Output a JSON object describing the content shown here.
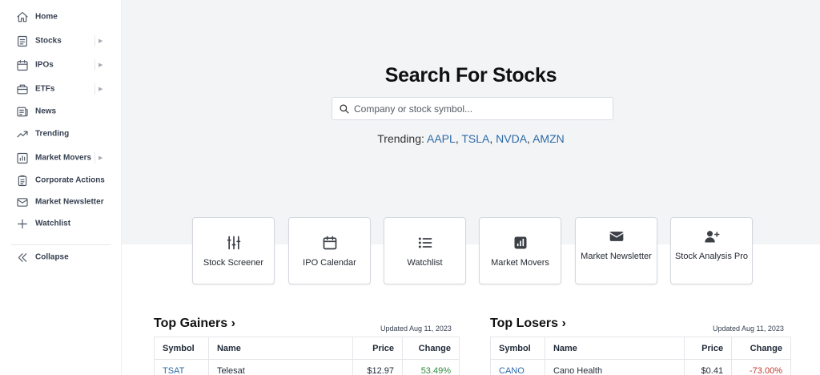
{
  "sidebar": {
    "items": [
      {
        "label": "Home",
        "icon": "home-icon",
        "expandable": false
      },
      {
        "label": "Stocks",
        "icon": "stocks-icon",
        "expandable": true
      },
      {
        "label": "IPOs",
        "icon": "calendar-icon",
        "expandable": true
      },
      {
        "label": "ETFs",
        "icon": "etf-icon",
        "expandable": true
      },
      {
        "label": "News",
        "icon": "news-icon",
        "expandable": false
      },
      {
        "label": "Trending",
        "icon": "trending-icon",
        "expandable": false
      },
      {
        "label": "Market Movers",
        "icon": "bar-chart-icon",
        "expandable": true
      },
      {
        "label": "Corporate Actions",
        "icon": "clipboard-icon",
        "expandable": false
      },
      {
        "label": "Market Newsletter",
        "icon": "envelope-icon",
        "expandable": false
      },
      {
        "label": "Watchlist",
        "icon": "plus-icon",
        "expandable": false
      }
    ],
    "collapse_label": "Collapse",
    "caret": "▶"
  },
  "hero": {
    "title": "Search For Stocks",
    "search_placeholder": "Company or stock symbol...",
    "trending_label": "Trending:",
    "trending_tickers": [
      "AAPL",
      "TSLA",
      "NVDA",
      "AMZN"
    ],
    "separator": ","
  },
  "tools": [
    {
      "label": "Stock Screener",
      "icon": "sliders-icon"
    },
    {
      "label": "IPO Calendar",
      "icon": "calendar-icon"
    },
    {
      "label": "Watchlist",
      "icon": "list-icon"
    },
    {
      "label": "Market Movers",
      "icon": "bar-chart-icon"
    },
    {
      "label": "Market Newsletter",
      "icon": "envelope-icon"
    },
    {
      "label": "Stock Analysis Pro",
      "icon": "user-plus-icon"
    }
  ],
  "gainers": {
    "title": "Top Gainers ›",
    "updated": "Updated Aug 11, 2023",
    "columns": [
      "Symbol",
      "Name",
      "Price",
      "Change"
    ],
    "rows": [
      {
        "symbol": "TSAT",
        "name": "Telesat",
        "price": "$12.97",
        "change": "53.49%"
      }
    ]
  },
  "losers": {
    "title": "Top Losers ›",
    "updated": "Updated Aug 11, 2023",
    "columns": [
      "Symbol",
      "Name",
      "Price",
      "Change"
    ],
    "rows": [
      {
        "symbol": "CANO",
        "name": "Cano Health",
        "price": "$0.41",
        "change": "-73.00%"
      }
    ]
  },
  "colors": {
    "link": "#2c6aa8",
    "positive": "#2f8a3e",
    "negative": "#c0392b",
    "hero_bg": "#f3f4f6"
  }
}
